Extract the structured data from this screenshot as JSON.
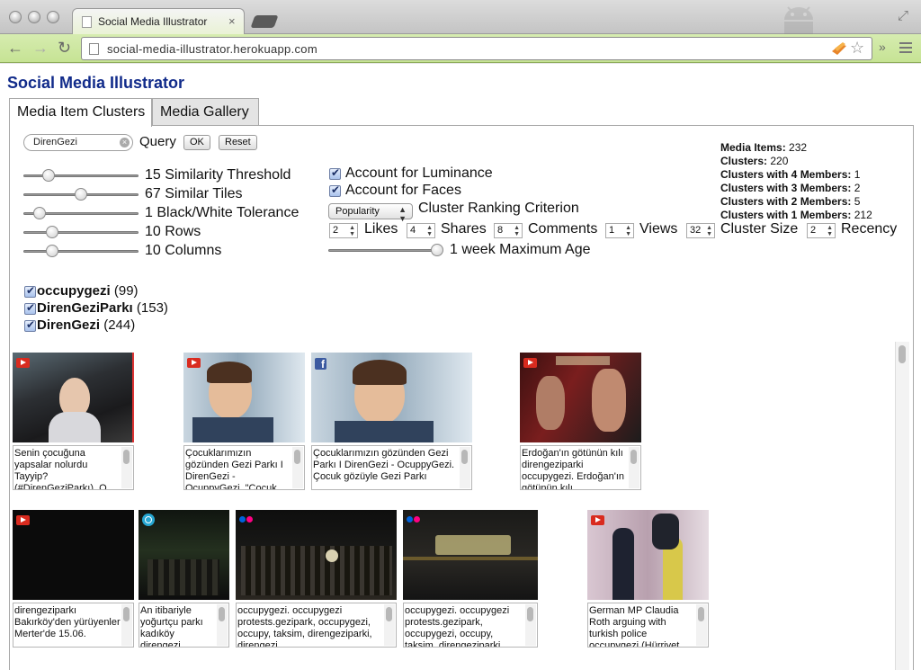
{
  "browser": {
    "tab_title": "Social Media Illustrator",
    "tab_close": "×",
    "url": "social-media-illustrator.herokuapp.com",
    "back": "←",
    "forward": "→",
    "reload": "↻",
    "more": "»"
  },
  "app": {
    "title": "Social Media Illustrator",
    "tabs": [
      {
        "label": "Media Item Clusters",
        "active": true
      },
      {
        "label": "Media Gallery",
        "active": false
      }
    ]
  },
  "query": {
    "value": "DirenGezi",
    "label": "Query",
    "ok_label": "OK",
    "reset_label": "Reset"
  },
  "sliders": [
    {
      "label": "15 Similarity Threshold",
      "value_fraction": 0.18
    },
    {
      "label": "67 Similar Tiles",
      "value_fraction": 0.5
    },
    {
      "label": "1 Black/White Tolerance",
      "value_fraction": 0.1
    },
    {
      "label": "10 Rows",
      "value_fraction": 0.22
    },
    {
      "label": "10 Columns",
      "value_fraction": 0.22
    }
  ],
  "options": {
    "luminance_label": "Account for Luminance",
    "faces_label": "Account for Faces",
    "ranking_select": "Popularity",
    "ranking_label": "Cluster Ranking Criterion",
    "weights": [
      {
        "value": "2",
        "label": "Likes"
      },
      {
        "value": "4",
        "label": "Shares"
      },
      {
        "value": "8",
        "label": "Comments"
      },
      {
        "value": "1",
        "label": "Views"
      },
      {
        "value": "32",
        "label": "Cluster Size"
      },
      {
        "value": "2",
        "label": "Recency"
      }
    ],
    "age_label": "1 week Maximum Age",
    "age_fraction": 0.95
  },
  "stats": {
    "media_items_label": "Media Items:",
    "media_items": "232",
    "clusters_label": "Clusters:",
    "clusters": "220",
    "c4_label": "Clusters with 4 Members:",
    "c4": "1",
    "c3_label": "Clusters with 3 Members:",
    "c3": "2",
    "c2_label": "Clusters with 2 Members:",
    "c2": "5",
    "c1_label": "Clusters with 1 Members:",
    "c1": "212"
  },
  "hashtags": [
    {
      "name": "occupygezi",
      "count": "(99)"
    },
    {
      "name": "DirenGeziParkı",
      "count": "(153)"
    },
    {
      "name": "DirenGezi",
      "count": "(244)"
    }
  ],
  "media": [
    {
      "source": "youtube",
      "caption": "Senin çocuğuna yapsalar nolurdu Tayyip? (#DirenGeziParkı). O"
    },
    {
      "source": "youtube",
      "caption": "Çocuklarımızın gözünden Gezi Parkı I DirenGezi - OcuppyGezi. \"Çocuk"
    },
    {
      "source": "facebook",
      "caption": "Çocuklarımızın gözünden Gezi Parkı I DirenGezi - OcuppyGezi. Çocuk gözüyle Gezi Parkı"
    },
    {
      "source": "youtube",
      "caption": "Erdoğan'ın götünün kılı direngeziparki occupygezi. Erdoğan'ın götünün kılı"
    },
    {
      "source": "youtube",
      "caption": "direngeziparkı Bakırköy'den yürüyenler Merter'de 15.06."
    },
    {
      "source": "twitpic",
      "caption": "An itibariyle yoğurtçu parkı kadıköy direngezi"
    },
    {
      "source": "flickr",
      "caption": "occupygezi. occupygezi protests.gezipark, occupygezi, occupy, taksim, direngeziparki, direngezi"
    },
    {
      "source": "flickr",
      "caption": "occupygezi. occupygezi protests.gezipark, occupygezi, occupy, taksim, direngeziparki,"
    },
    {
      "source": "youtube",
      "caption": "German MP Claudia Roth arguing with turkish police occupygezi (Hürriyet"
    }
  ]
}
